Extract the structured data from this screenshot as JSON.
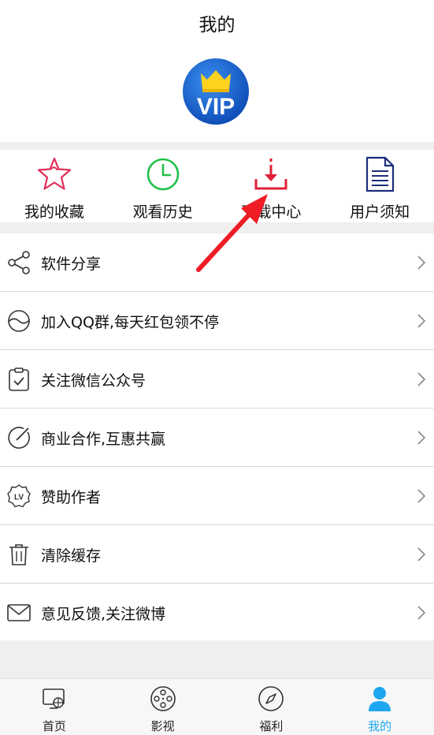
{
  "header": {
    "title": "我的",
    "avatar_text": "VIP"
  },
  "quick_actions": [
    {
      "label": "我的收藏",
      "icon": "star-icon"
    },
    {
      "label": "观看历史",
      "icon": "clock-icon"
    },
    {
      "label": "下载中心",
      "icon": "download-icon"
    },
    {
      "label": "用户须知",
      "icon": "document-icon"
    }
  ],
  "menu": [
    {
      "label": "软件分享",
      "icon": "share-icon"
    },
    {
      "label": "加入QQ群,每天红包领不停",
      "icon": "group-icon"
    },
    {
      "label": "关注微信公众号",
      "icon": "clipboard-check-icon"
    },
    {
      "label": "商业合作,互惠共赢",
      "icon": "pen-circle-icon"
    },
    {
      "label": "赞助作者",
      "icon": "lv-badge-icon"
    },
    {
      "label": "清除缓存",
      "icon": "trash-icon"
    },
    {
      "label": "意见反馈,关注微博",
      "icon": "mail-icon"
    }
  ],
  "tabs": [
    {
      "label": "首页",
      "icon": "monitor-globe-icon",
      "active": false
    },
    {
      "label": "影视",
      "icon": "film-reel-icon",
      "active": false
    },
    {
      "label": "福利",
      "icon": "compass-icon",
      "active": false
    },
    {
      "label": "我的",
      "icon": "user-icon",
      "active": true
    }
  ],
  "colors": {
    "star": "#e0305a",
    "clock": "#22c04a",
    "download": "#e0203a",
    "document": "#1c2d7a",
    "tab_active": "#1ea7f0",
    "annotation_arrow": "#ee1c25"
  }
}
